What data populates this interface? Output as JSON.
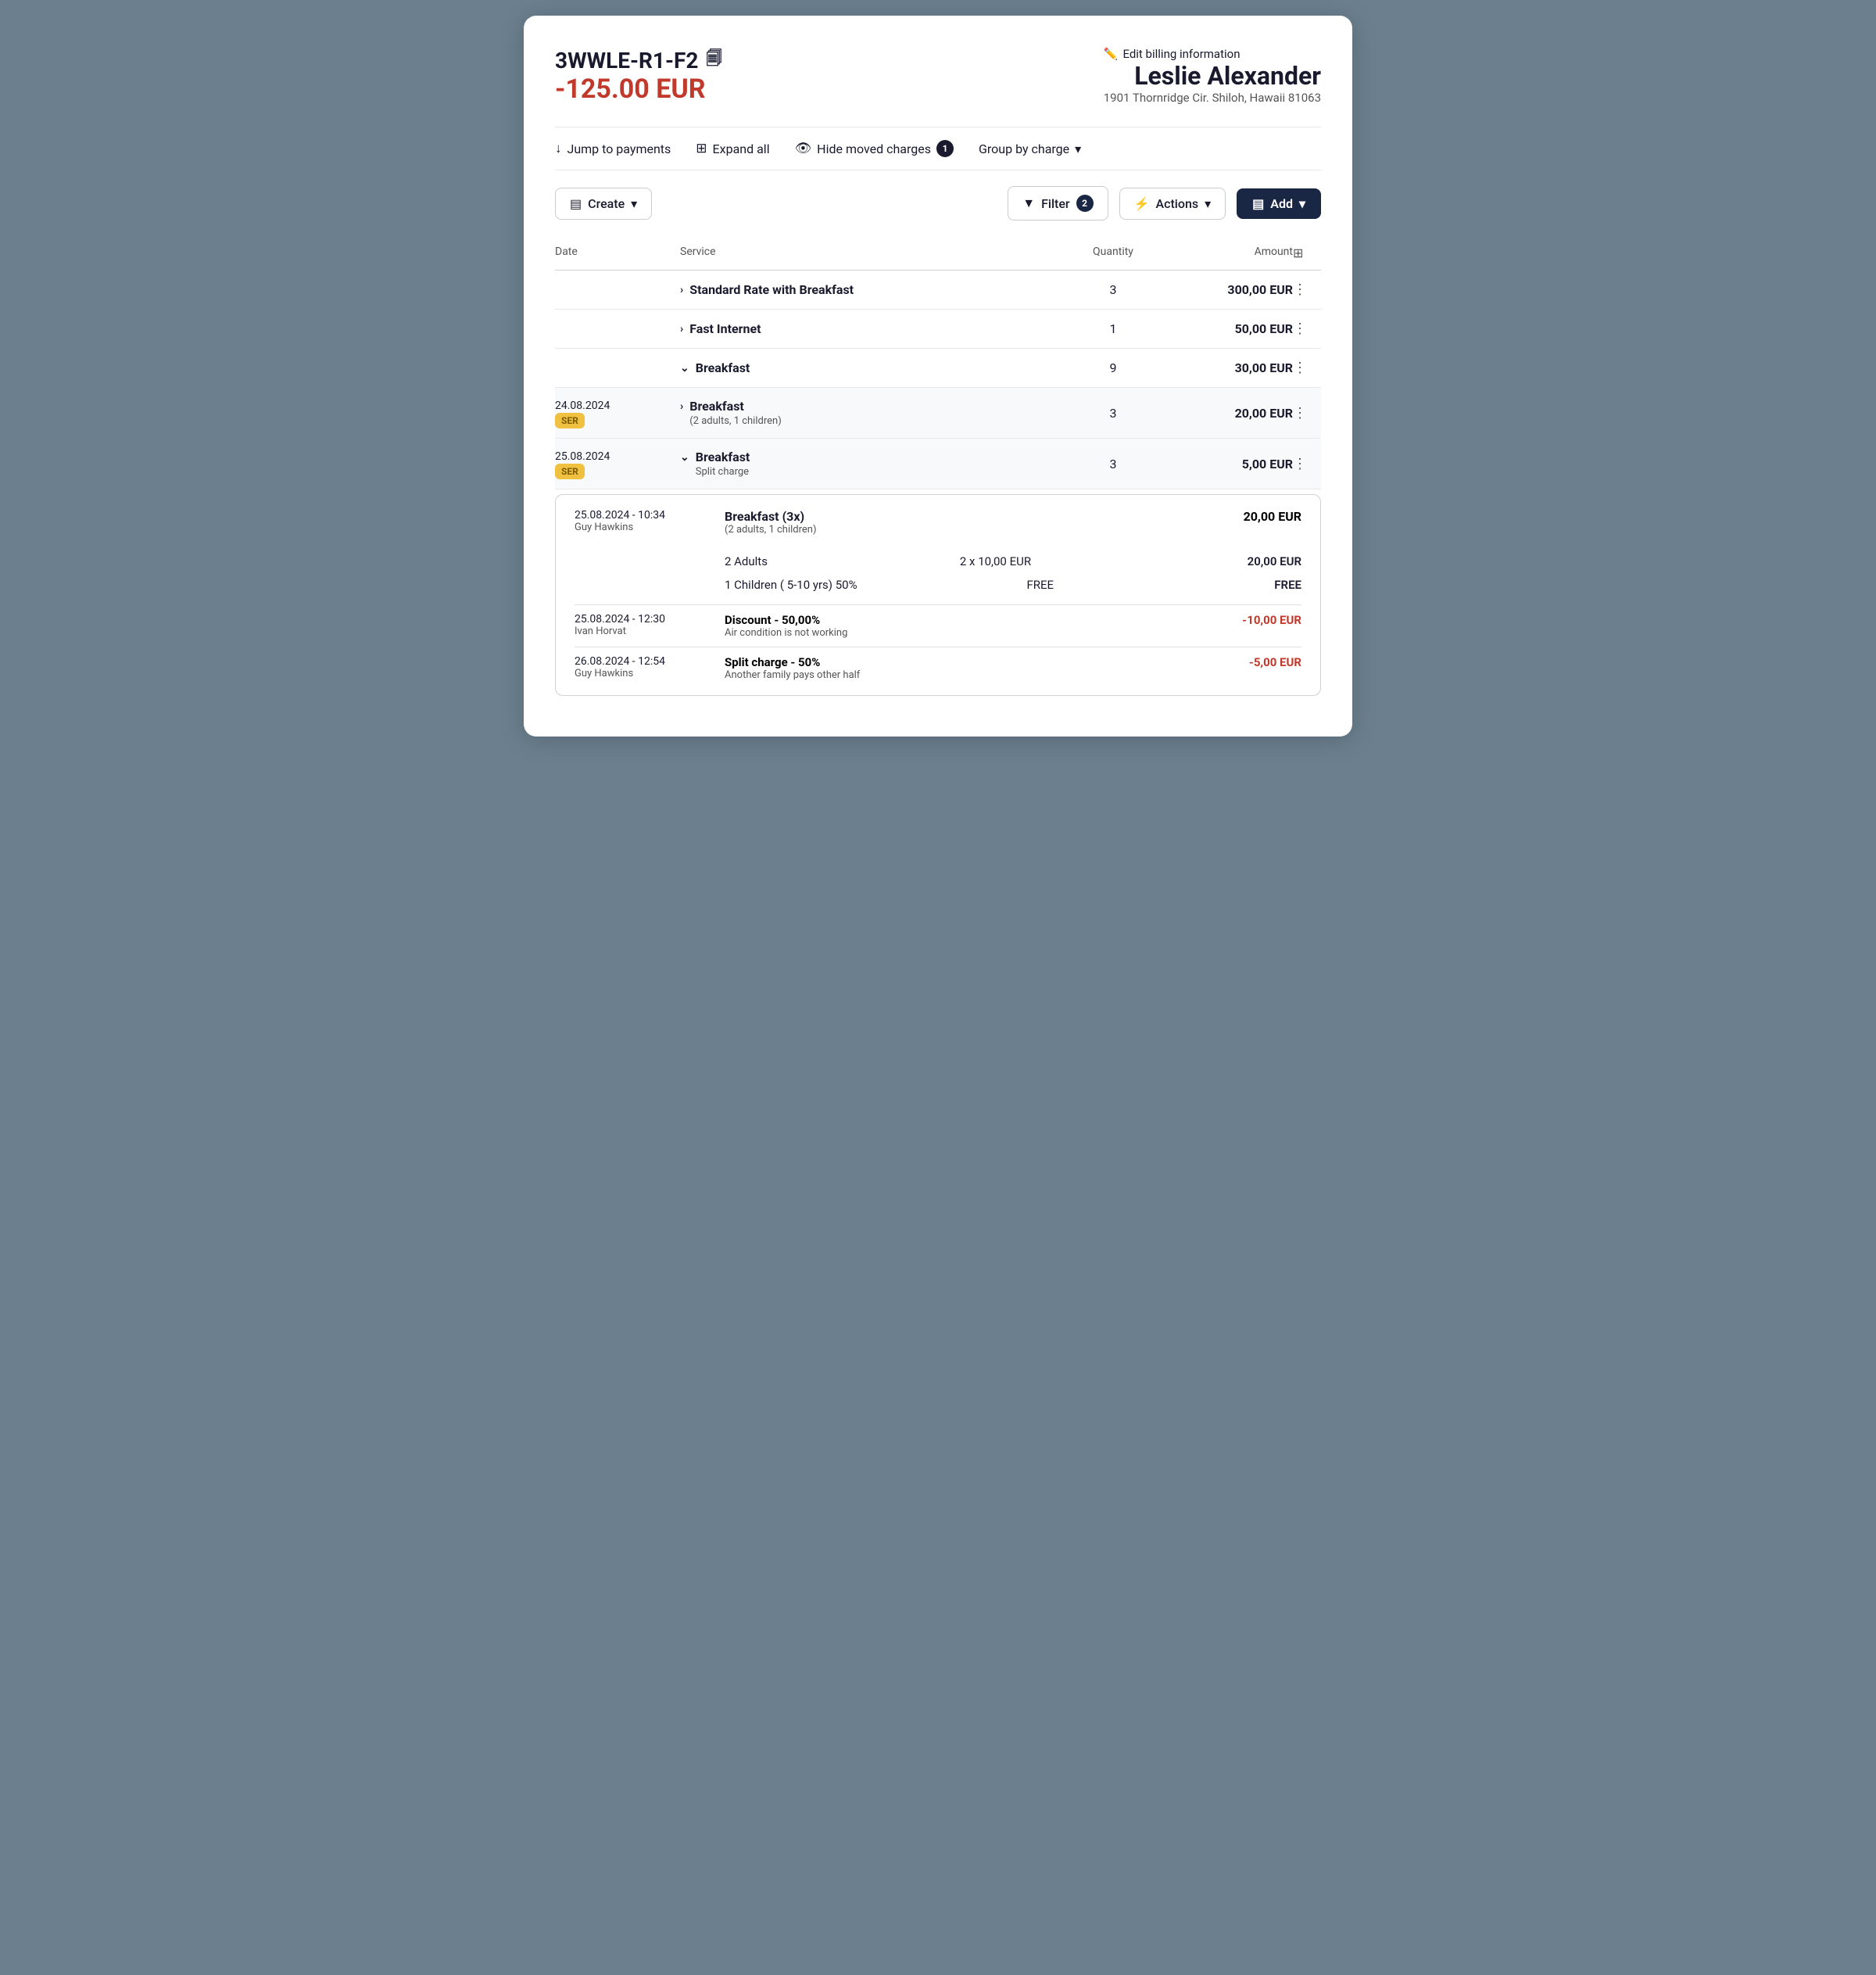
{
  "header": {
    "booking_id": "3WWLE-R1-F2",
    "copy_icon": "📋",
    "amount": "-125.00 EUR",
    "edit_billing_label": "Edit billing information",
    "guest_name": "Leslie Alexander",
    "guest_address": "1901 Thornridge Cir. Shiloh, Hawaii 81063"
  },
  "toolbar": {
    "jump_to_payments": "Jump to payments",
    "expand_all": "Expand all",
    "hide_moved_charges": "Hide moved charges",
    "hide_moved_badge": "1",
    "group_by_charge": "Group by charge"
  },
  "actions_bar": {
    "create_label": "Create",
    "filter_label": "Filter",
    "filter_badge": "2",
    "actions_label": "Actions",
    "add_label": "Add"
  },
  "table": {
    "columns": {
      "date": "Date",
      "service": "Service",
      "quantity": "Quantity",
      "amount": "Amount"
    },
    "rows": [
      {
        "id": "row1",
        "collapsed": true,
        "label": "Standard Rate with Breakfast",
        "quantity": "3",
        "amount": "300,00 EUR",
        "has_dots": true
      },
      {
        "id": "row2",
        "collapsed": true,
        "label": "Fast Internet",
        "quantity": "1",
        "amount": "50,00 EUR",
        "has_dots": true
      },
      {
        "id": "row3",
        "collapsed": false,
        "label": "Breakfast",
        "quantity": "9",
        "amount": "30,00 EUR",
        "has_dots": true
      },
      {
        "id": "row4",
        "date": "24.08.2024",
        "badge": "SER",
        "collapsed": true,
        "label": "Breakfast",
        "sub_label": "(2 adults, 1 children)",
        "quantity": "3",
        "amount": "20,00 EUR",
        "has_dots": true,
        "indent": true
      },
      {
        "id": "row5",
        "date": "25.08.2024",
        "badge": "SER",
        "collapsed": false,
        "label": "Breakfast",
        "sub_label": "Split charge",
        "quantity": "3",
        "amount": "5,00 EUR",
        "has_dots": true,
        "indent": true
      }
    ],
    "detail_card": {
      "date_time": "25.08.2024 - 10:34",
      "user": "Guy Hawkins",
      "title": "Breakfast  (3x)",
      "sub": "(2 adults, 1 children)",
      "amount": "20,00 EUR",
      "lines": [
        {
          "label": "2 Adults",
          "unit": "2 x 10,00 EUR",
          "amount": "20,00 EUR"
        },
        {
          "label": "1 Children ( 5-10 yrs) 50%",
          "unit": "FREE",
          "amount": "FREE"
        }
      ],
      "discount": {
        "date_time": "25.08.2024 - 12:30",
        "user": "Ivan Horvat",
        "label": "Discount - 50,00%",
        "sub": "Air condition is not working",
        "amount": "-10,00 EUR"
      },
      "split": {
        "date_time": "26.08.2024 - 12:54",
        "user": "Guy Hawkins",
        "label": "Split charge - 50%",
        "sub": "Another family pays other half",
        "amount": "-5,00 EUR"
      }
    }
  }
}
